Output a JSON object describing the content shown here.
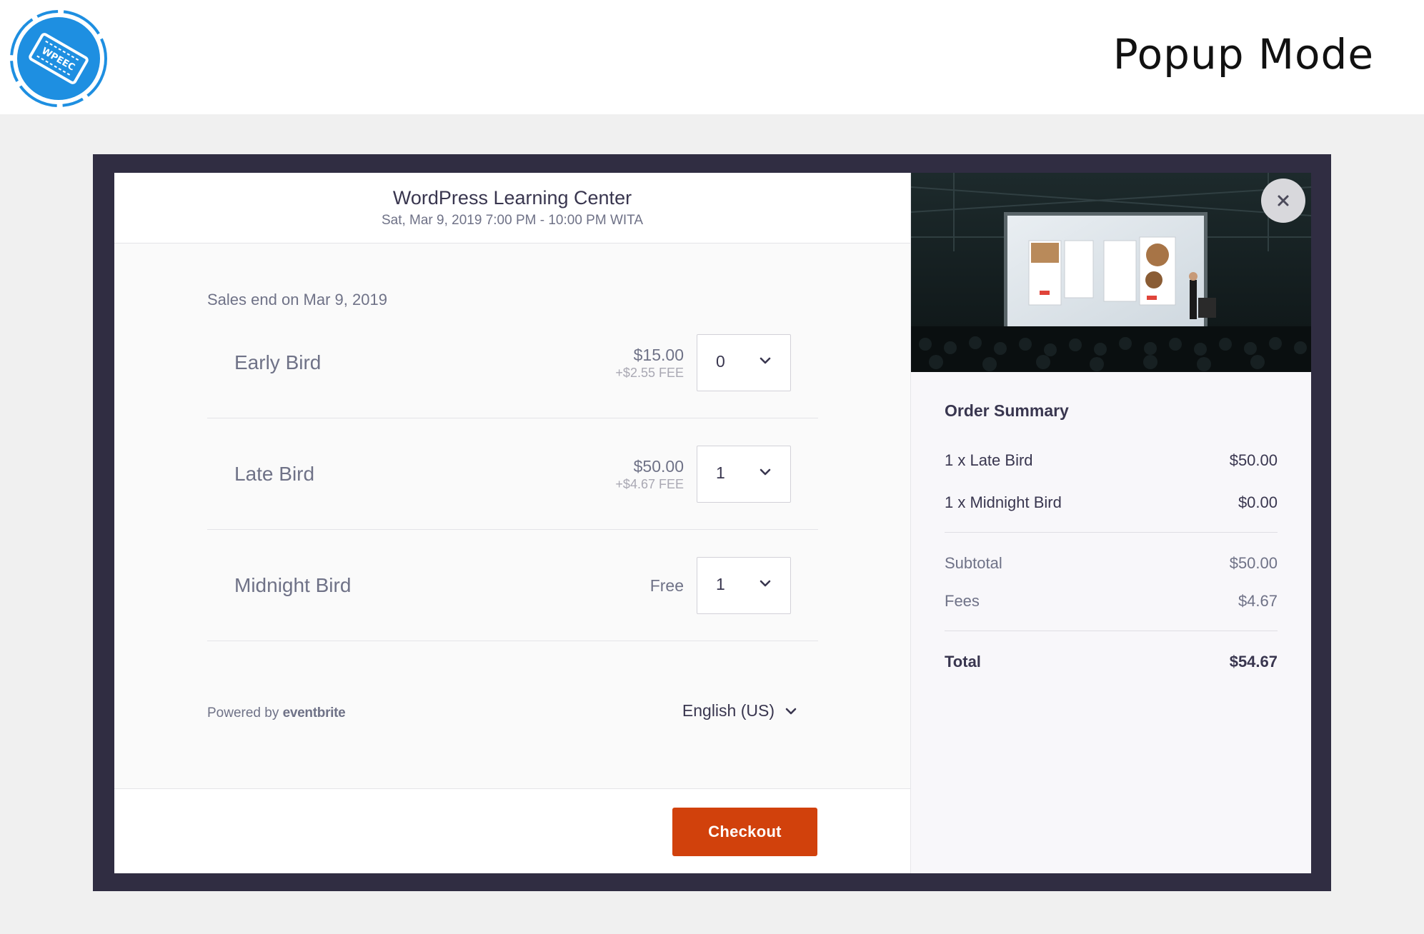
{
  "page": {
    "title": "Popup Mode",
    "logo_text": "WPEEC"
  },
  "event": {
    "title": "WordPress Learning Center",
    "date": "Sat, Mar 9, 2019 7:00 PM - 10:00 PM WITA",
    "sales_end": "Sales end on Mar 9, 2019"
  },
  "tickets": [
    {
      "name": "Early Bird",
      "price": "$15.00",
      "fee": "+$2.55 FEE",
      "qty": "0"
    },
    {
      "name": "Late Bird",
      "price": "$50.00",
      "fee": "+$4.67 FEE",
      "qty": "1"
    },
    {
      "name": "Midnight Bird",
      "price": "Free",
      "fee": "",
      "qty": "1"
    }
  ],
  "footer": {
    "powered_prefix": "Powered by",
    "powered_brand": "eventbrite",
    "language": "English (US)",
    "checkout_label": "Checkout"
  },
  "summary": {
    "title": "Order Summary",
    "items": [
      {
        "label": "1 x Late Bird",
        "amount": "$50.00"
      },
      {
        "label": "1 x Midnight Bird",
        "amount": "$0.00"
      }
    ],
    "subtotal_label": "Subtotal",
    "subtotal": "$50.00",
    "fees_label": "Fees",
    "fees": "$4.67",
    "total_label": "Total",
    "total": "$54.67"
  },
  "icons": {
    "close": "close-icon",
    "chevron": "chevron-down-icon",
    "logo": "ticket-logo-icon"
  },
  "colors": {
    "accent": "#d1410c",
    "frame": "#302d42",
    "logo_blue": "#1e8fe1"
  }
}
